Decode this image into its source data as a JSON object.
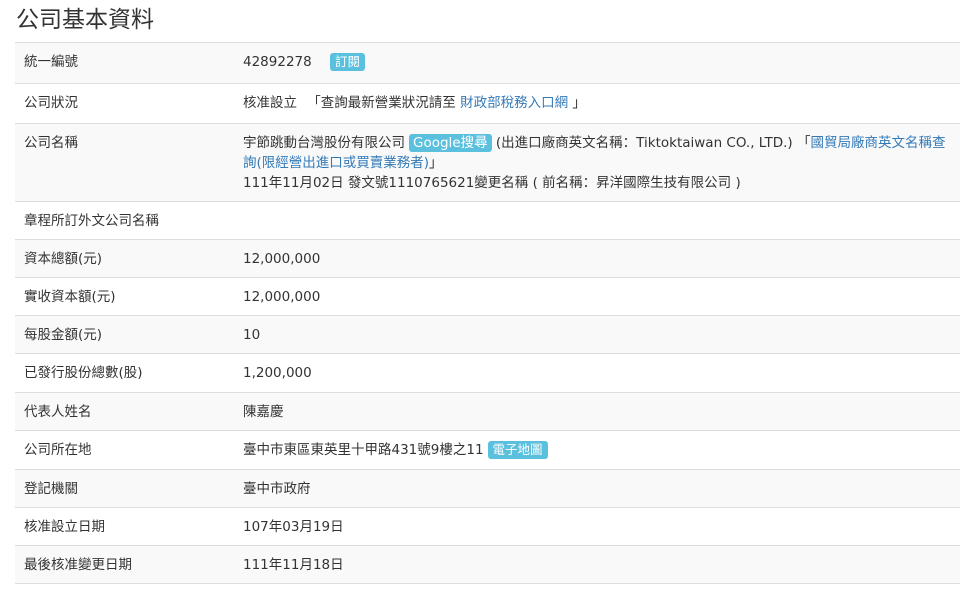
{
  "title": "公司基本資料",
  "rows": {
    "ubn": {
      "label": "統一編號",
      "value": "42892278",
      "subscribe": "訂閱"
    },
    "status": {
      "label": "公司狀況",
      "value": "核准設立",
      "prefix": "「查詢最新營業狀況請至",
      "link": "財政部稅務入口網",
      "suffix": "」"
    },
    "name": {
      "label": "公司名稱",
      "value": "宇節跳動台灣股份有限公司",
      "google": "Google搜尋",
      "english_prefix": "(出進口廠商英文名稱：Tiktoktaiwan CO., LTD.) 「",
      "trade_link": "國貿局廠商英文名稱查詢(限經營出進口或買賣業務者)",
      "english_suffix": "」",
      "change_note": "111年11月02日 發文號1110765621變更名稱 ( 前名稱：昇洋國際生技有限公司 )"
    },
    "foreign_name": {
      "label": "章程所訂外文公司名稱",
      "value": ""
    },
    "capital_total": {
      "label": "資本總額(元)",
      "value": "12,000,000"
    },
    "capital_paid": {
      "label": "實收資本額(元)",
      "value": "12,000,000"
    },
    "par_value": {
      "label": "每股金額(元)",
      "value": "10"
    },
    "shares_issued": {
      "label": "已發行股份總數(股)",
      "value": "1,200,000"
    },
    "representative": {
      "label": "代表人姓名",
      "value": "陳嘉慶"
    },
    "address": {
      "label": "公司所在地",
      "value": "臺中市東區東英里十甲路431號9樓之11",
      "map": "電子地圖"
    },
    "authority": {
      "label": "登記機關",
      "value": "臺中市政府"
    },
    "approved_date": {
      "label": "核准設立日期",
      "value": "107年03月19日"
    },
    "last_change_date": {
      "label": "最後核准變更日期",
      "value": "111年11月18日"
    }
  },
  "colors": {
    "badge": "#5bc0de",
    "link": "#337ab7",
    "stripe": "#f9f9f9",
    "border": "#dddddd"
  }
}
